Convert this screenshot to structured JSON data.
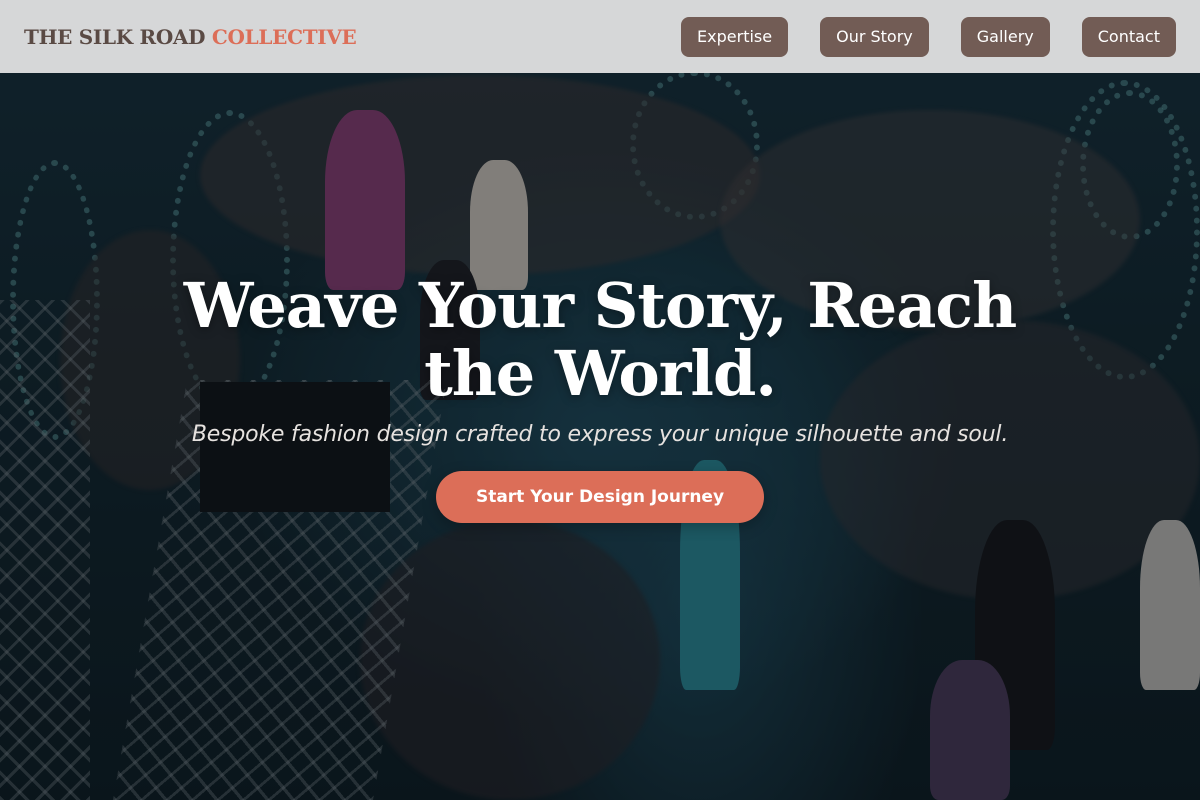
{
  "header": {
    "brand_main": "THE SILK ROAD",
    "brand_accent": "COLLECTIVE",
    "nav": [
      {
        "label": "Expertise"
      },
      {
        "label": "Our Story"
      },
      {
        "label": "Gallery"
      },
      {
        "label": "Contact"
      }
    ]
  },
  "hero": {
    "title": "Weave Your Story, Reach the World.",
    "subtitle": "Bespoke fashion design crafted to express your unique silhouette and soul.",
    "cta_label": "Start Your Design Journey",
    "background": "fashion-runway-photo"
  },
  "colors": {
    "accent": "#dc6e58",
    "nav_button": "#725c55",
    "header_bg": "#e1e1e1",
    "brand_text": "#5a4a44"
  }
}
